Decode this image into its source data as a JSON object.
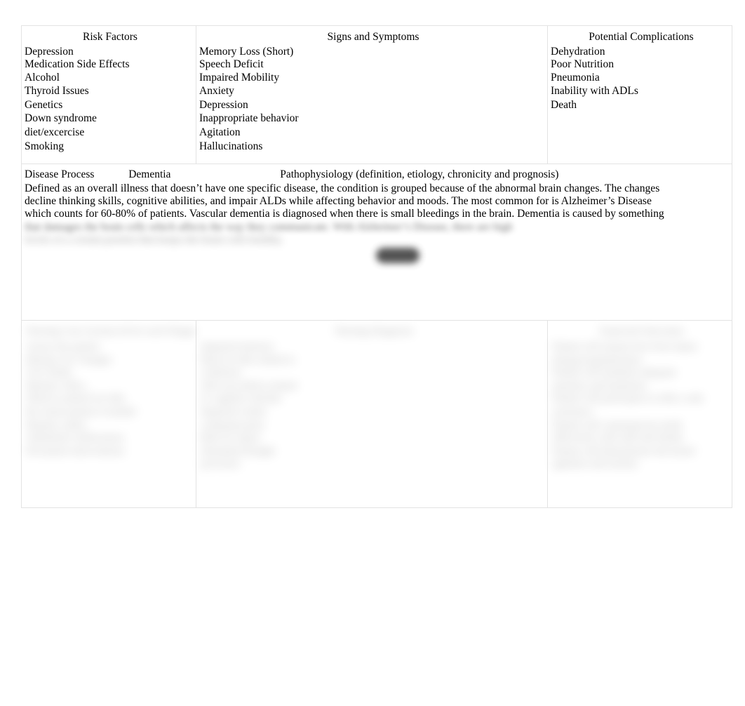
{
  "document": {
    "type": "nursing-concept-map",
    "legibility_note": "lower portions of the document are blurred / obscured in the source image"
  },
  "top_row": {
    "risk_factors": {
      "title": "Risk Factors",
      "items": [
        "Depression",
        "Medication Side Effects",
        "Alcohol",
        "Thyroid Issues",
        "Genetics",
        "Down syndrome",
        "diet/excercise",
        "Smoking"
      ]
    },
    "signs_and_symptoms": {
      "title": "Signs and Symptoms",
      "items": [
        "Memory Loss (Short)",
        "Speech Deficit",
        "Impaired Mobility",
        "Anxiety",
        "Depression",
        "Inappropriate behavior",
        "Agitation",
        "Hallucinations"
      ]
    },
    "potential_complications": {
      "title": "Potential Complications",
      "items": [
        "Dehydration",
        "Poor Nutrition",
        "Pneumonia",
        "Inability with ADLs",
        "Death"
      ]
    }
  },
  "middle_row": {
    "disease_process_label": "Disease Process",
    "disease_name": "Dementia",
    "pathophysiology_label": "Pathophysiology (definition, etiology, chronicity and prognosis)",
    "paragraph_lines": [
      "Defined as an overall illness that doesn’t have one specific disease, the condition is grouped because of the abnormal brain changes. The changes",
      "decline thinking skills, cognitive abilities, and impair ALDs while affecting behavior and moods. The most common for is Alzheimer’s Disease",
      "which counts for 60-80% of patients. Vascular dementia is diagnosed when there is small bleedings in the brain. Dementia is caused by something"
    ],
    "obscured_lines": [
      "that damages the brain cells which affects the way they communicate. With Alzheimer’s Disease, there are high",
      "levels of a certain protein that keeps the brain cells healthy."
    ],
    "redacted_mark": "redacted-text-blob"
  },
  "bottom_row": {
    "left_cell": {
      "title": "Nursing Care Actions (8 for each Diagnosis, etc.)",
      "lines": [
        "Assess the patient",
        "Monitor for Changes",
        "Give fluids",
        "Monitor ADLs",
        "Observe patient for falls",
        "Re-orient patient if needed",
        "Monitor safety",
        "Administer medications",
        "Document interventions"
      ]
    },
    "middle_cell": {
      "title": "Nursing Diagnosis",
      "lines": [
        "Impaired memory",
        "Risk for falls related to",
        "confusion",
        "Self-care deficit related",
        "to cognitive decline",
        "Impaired verbal",
        "communication",
        "Risk for injury",
        "Disturbed thought",
        "processes"
      ]
    },
    "right_cell": {
      "title": "Expected Outcomes",
      "lines": [
        "Patient will remain free from injury",
        "during hospitalization",
        "Patient will maintain adequate",
        "nutrition and hydration",
        "Patient will participate in ADLs with",
        "assistance",
        "Patient will communicate needs",
        "effectively with staff and family",
        "Patient will demonstrate decreased",
        "agitation and anxiety"
      ]
    }
  }
}
